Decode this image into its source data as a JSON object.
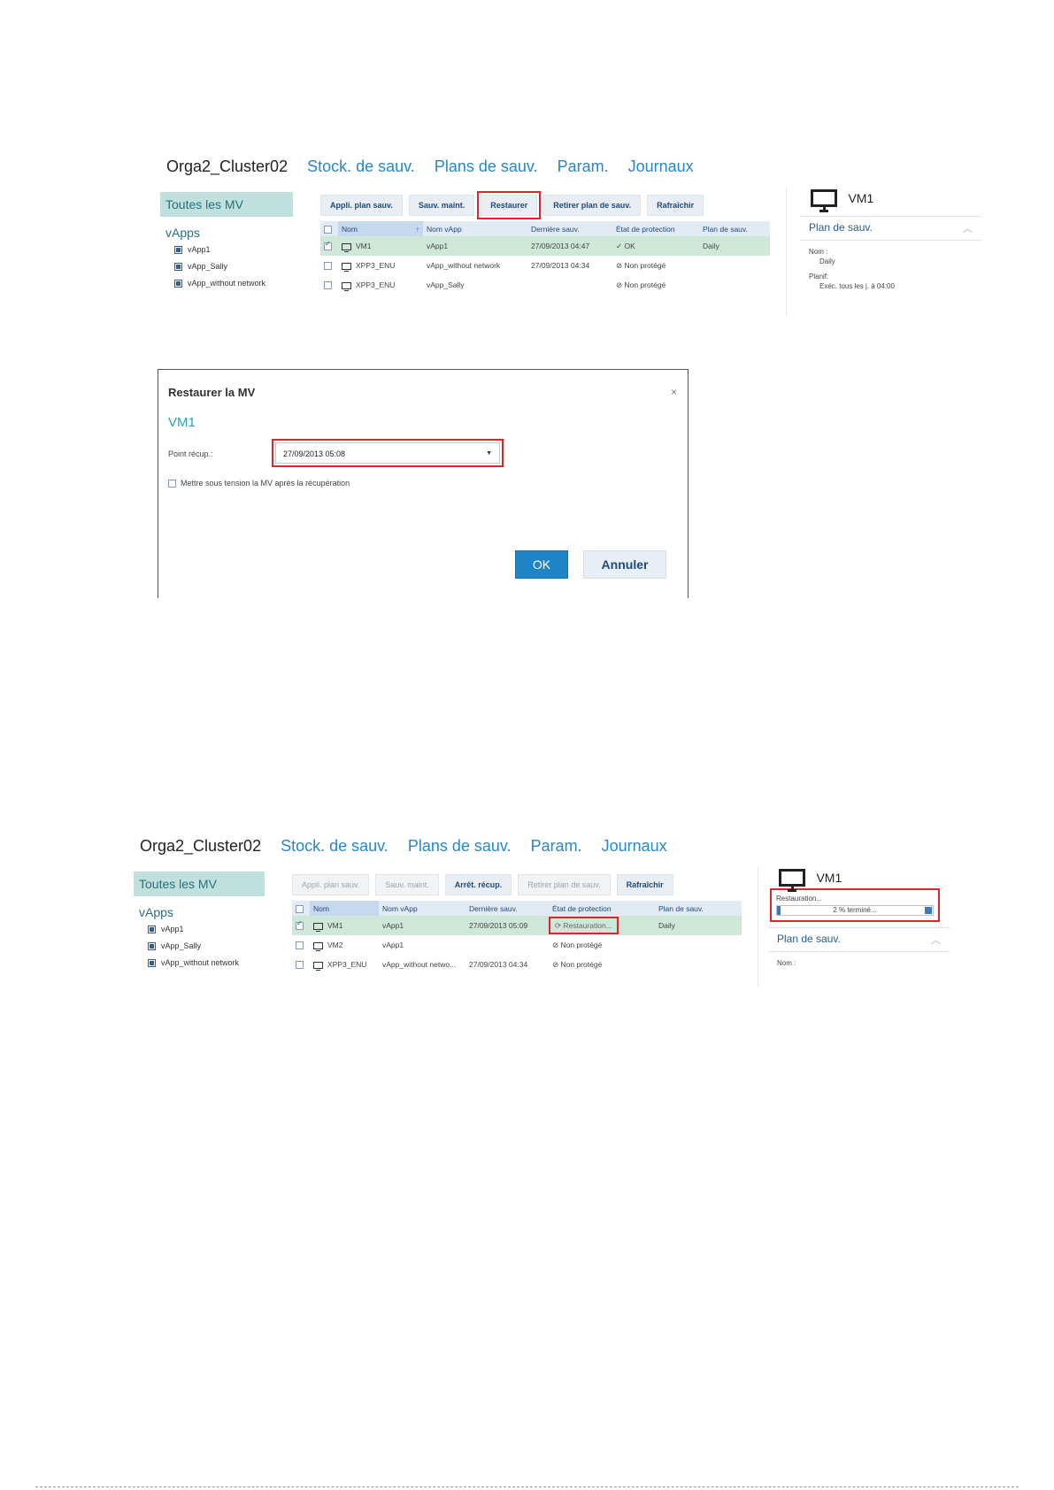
{
  "top": {
    "nav": {
      "org": "Orga2_Cluster02",
      "links": [
        "Stock. de sauv.",
        "Plans de sauv.",
        "Param.",
        "Journaux"
      ]
    },
    "sidebar": {
      "all_vms": "Toutes les MV",
      "vapps_heading": "vApps",
      "vapps": [
        "vApp1",
        "vApp_Sally",
        "vApp_without network"
      ]
    },
    "toolbar": [
      "Appli. plan sauv.",
      "Sauv. maint.",
      "Restaurer",
      "Retirer plan de sauv.",
      "Rafraîchir"
    ],
    "table": {
      "headers": [
        "Nom",
        "Nom vApp",
        "Dernière sauv.",
        "État de protection",
        "Plan de sauv."
      ],
      "sort_icon": "↑",
      "rows": [
        {
          "name": "VM1",
          "vapp": "vApp1",
          "last": "27/09/2013 04:47",
          "state_icon": "✓",
          "state": "OK",
          "plan": "Daily"
        },
        {
          "name": "XPP3_ENU",
          "vapp": "vApp_without network",
          "last": "27/09/2013 04:34",
          "state_icon": "⊘",
          "state": "Non protégé",
          "plan": ""
        },
        {
          "name": "XPP3_ENU",
          "vapp": "vApp_Sally",
          "last": "",
          "state_icon": "⊘",
          "state": "Non protégé",
          "plan": ""
        }
      ]
    },
    "detail": {
      "vm_name": "VM1",
      "section": "Plan de sauv.",
      "nom_label": "Nom :",
      "nom_value": "Daily",
      "planif_label": "Planif:",
      "planif_value": "Exéc. tous les j. à 04:00"
    }
  },
  "dialog": {
    "title": "Restaurer la MV",
    "close": "×",
    "vm": "VM1",
    "recovery_point_label": "Point récup.:",
    "recovery_point_value": "27/09/2013 05:08",
    "power_on_label": "Mettre sous tension la MV après la récupération",
    "ok": "OK",
    "cancel": "Annuler"
  },
  "bottom": {
    "nav": {
      "org": "Orga2_Cluster02",
      "links": [
        "Stock. de sauv.",
        "Plans de sauv.",
        "Param.",
        "Journaux"
      ]
    },
    "sidebar": {
      "all_vms": "Toutes les MV",
      "vapps_heading": "vApps",
      "vapps": [
        "vApp1",
        "vApp_Sally",
        "vApp_without network"
      ]
    },
    "toolbar": [
      "Appli. plan sauv.",
      "Sauv. maint.",
      "Arrêt. récup.",
      "Retirer plan de sauv.",
      "Rafraîchir"
    ],
    "table": {
      "headers": [
        "Nom",
        "Nom vApp",
        "Dernière sauv.",
        "État de protection",
        "Plan de sauv."
      ],
      "rows": [
        {
          "name": "VM1",
          "vapp": "vApp1",
          "last": "27/09/2013 05:09",
          "state_icon": "⟳",
          "state": "Restauration...",
          "plan": "Daily"
        },
        {
          "name": "VM2",
          "vapp": "vApp1",
          "last": "",
          "state_icon": "⊘",
          "state": "Non protégé",
          "plan": ""
        },
        {
          "name": "XPP3_ENU",
          "vapp": "vApp_without netwo...",
          "last": "27/09/2013 04:34",
          "state_icon": "⊘",
          "state": "Non protégé",
          "plan": ""
        }
      ]
    },
    "detail": {
      "vm_name": "VM1",
      "progress_label": "Restauration...",
      "progress_text": "2 % terminé...",
      "progress_fraction": 0.02,
      "section": "Plan de sauv.",
      "nom_label": "Nom :"
    }
  },
  "colors": {
    "accent": "#2a86c6",
    "selected_row": "#cfe7d9",
    "highlight": "#e0242b",
    "ok_green": "#2bb07a"
  }
}
